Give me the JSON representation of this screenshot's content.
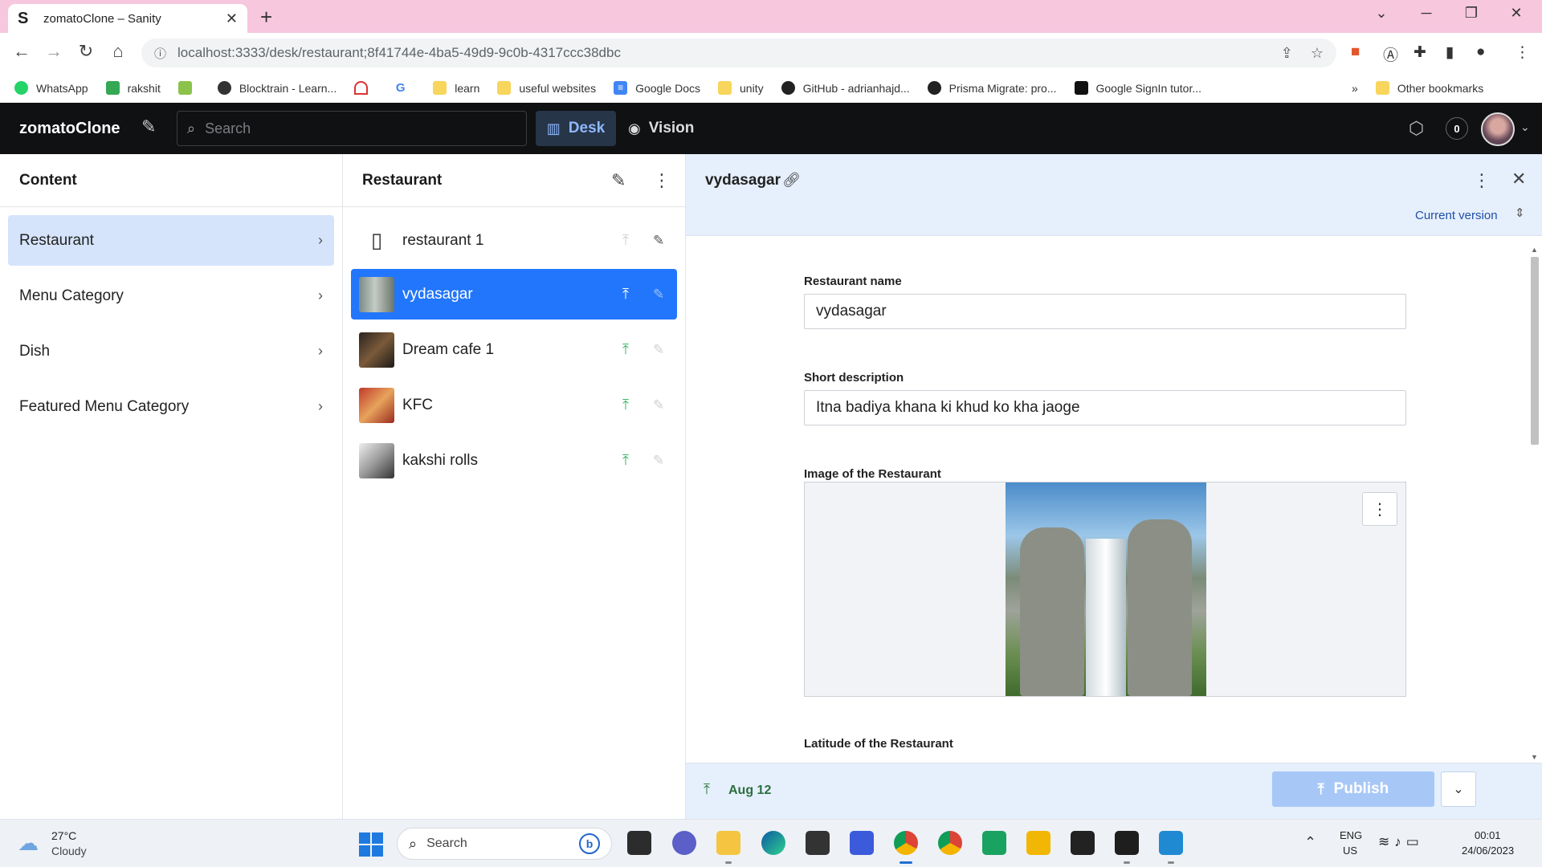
{
  "browser": {
    "tab_favicon": "S",
    "tab_title": "zomatoClone – Sanity",
    "url": "localhost:3333/desk/restaurant;8f41744e-4ba5-49d9-9c0b-4317ccc38dbc",
    "bookmarks": [
      "WhatsApp",
      "rakshit",
      "",
      "Blocktrain - Learn...",
      "",
      "",
      "learn",
      "useful websites",
      "Google Docs",
      "unity",
      "GitHub - adrianhajd...",
      "Prisma Migrate: pro...",
      "Google SignIn tutor..."
    ],
    "bookmarks_more": "»",
    "other_bookmarks": "Other bookmarks"
  },
  "appbar": {
    "logo": "zomatoClone",
    "search_placeholder": "Search",
    "desk_label": "Desk",
    "vision_label": "Vision",
    "notifications_count": "0"
  },
  "content_pane": {
    "title": "Content",
    "items": [
      {
        "label": "Restaurant",
        "active": true
      },
      {
        "label": "Menu Category"
      },
      {
        "label": "Dish"
      },
      {
        "label": "Featured Menu Category"
      }
    ]
  },
  "list_pane": {
    "title": "Restaurant",
    "documents": [
      {
        "label": "restaurant 1"
      },
      {
        "label": "vydasagar"
      },
      {
        "label": "Dream cafe 1"
      },
      {
        "label": "KFC"
      },
      {
        "label": "kakshi rolls"
      }
    ]
  },
  "document": {
    "title": "vydasagar",
    "version_label": "Current version",
    "fields": {
      "name_label": "Restaurant name",
      "name_value": "vydasagar",
      "desc_label": "Short description",
      "desc_value": "Itna badiya khana ki khud ko kha jaoge",
      "image_label": "Image of the Restaurant",
      "latitude_label": "Latitude of the Restaurant"
    },
    "footer": {
      "published_date": "Aug 12",
      "publish_label": "Publish"
    }
  },
  "taskbar": {
    "weather_temp": "27°C",
    "weather_desc": "Cloudy",
    "search_placeholder": "Search",
    "lang_line1": "ENG",
    "lang_line2": "US",
    "time": "00:01",
    "date": "24/06/2023"
  },
  "colors": {
    "accent": "#2276fc",
    "tabstrip": "#f7c7de",
    "appbar": "#101112",
    "published_green": "#3ab667"
  }
}
